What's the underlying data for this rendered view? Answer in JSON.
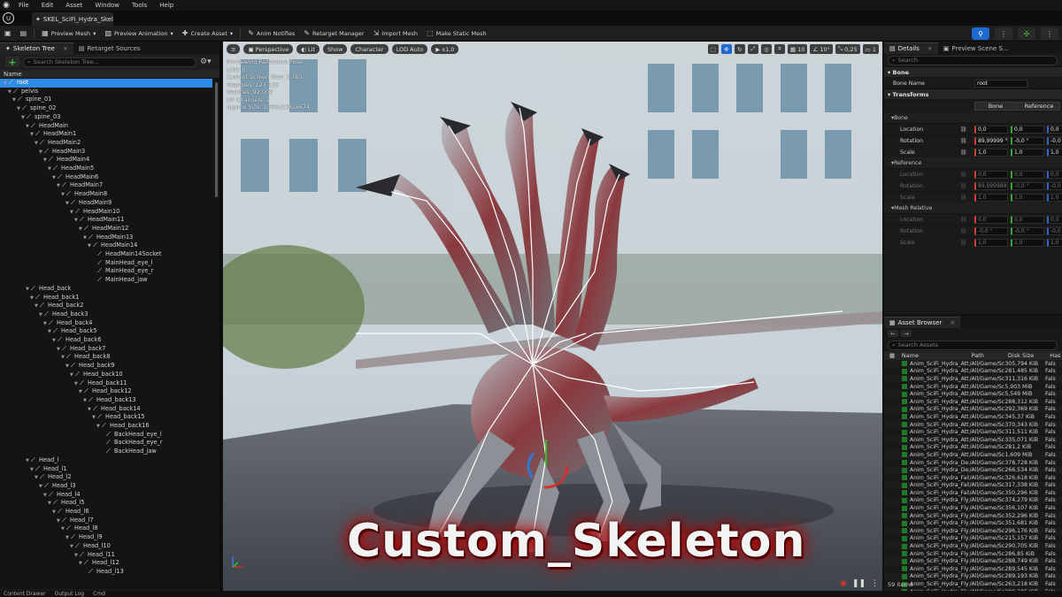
{
  "menu": [
    "File",
    "Edit",
    "Asset",
    "Window",
    "Tools",
    "Help"
  ],
  "document_tab": "SKEL_SciFi_Hydra_Skel...",
  "toolbar": {
    "preview_mesh": "Preview Mesh",
    "preview_animation": "Preview Animation",
    "create_asset": "Create Asset",
    "anim_notifies": "Anim Notifies",
    "retarget_manager": "Retarget Manager",
    "import_mesh": "Import Mesh",
    "make_static_mesh": "Make Static Mesh"
  },
  "left_panel": {
    "tabs": [
      "Skeleton Tree",
      "Retarget Sources"
    ],
    "search_placeholder": "Search Skeleton Tree...",
    "column_name": "Name"
  },
  "skeleton_tree": [
    {
      "name": "root",
      "depth": 0
    },
    {
      "name": "pelvis",
      "depth": 1
    },
    {
      "name": "spine_01",
      "depth": 2
    },
    {
      "name": "spine_02",
      "depth": 3
    },
    {
      "name": "spine_03",
      "depth": 4
    },
    {
      "name": "HeadMain",
      "depth": 5
    },
    {
      "name": "HeadMain1",
      "depth": 6
    },
    {
      "name": "HeadMain2",
      "depth": 7
    },
    {
      "name": "HeadMain3",
      "depth": 8
    },
    {
      "name": "HeadMain4",
      "depth": 9
    },
    {
      "name": "HeadMain5",
      "depth": 10
    },
    {
      "name": "HeadMain6",
      "depth": 11
    },
    {
      "name": "HeadMain7",
      "depth": 12
    },
    {
      "name": "HeadMain8",
      "depth": 13
    },
    {
      "name": "HeadMain9",
      "depth": 14
    },
    {
      "name": "HeadMain10",
      "depth": 15
    },
    {
      "name": "HeadMain11",
      "depth": 16
    },
    {
      "name": "HeadMain12",
      "depth": 17
    },
    {
      "name": "HeadMain13",
      "depth": 18
    },
    {
      "name": "HeadMain14",
      "depth": 19
    },
    {
      "name": "HeadMain14Socket",
      "depth": 20
    },
    {
      "name": "MainHead_eye_l",
      "depth": 20
    },
    {
      "name": "MainHead_eye_r",
      "depth": 20
    },
    {
      "name": "MainHead_jaw",
      "depth": 20
    },
    {
      "name": "Head_back",
      "depth": 5
    },
    {
      "name": "Head_back1",
      "depth": 6
    },
    {
      "name": "Head_back2",
      "depth": 7
    },
    {
      "name": "Head_back3",
      "depth": 8
    },
    {
      "name": "Head_back4",
      "depth": 9
    },
    {
      "name": "Head_back5",
      "depth": 10
    },
    {
      "name": "Head_back6",
      "depth": 11
    },
    {
      "name": "Head_back7",
      "depth": 12
    },
    {
      "name": "Head_back8",
      "depth": 13
    },
    {
      "name": "Head_back9",
      "depth": 14
    },
    {
      "name": "Head_back10",
      "depth": 15
    },
    {
      "name": "Head_back11",
      "depth": 16
    },
    {
      "name": "Head_back12",
      "depth": 17
    },
    {
      "name": "Head_back13",
      "depth": 18
    },
    {
      "name": "Head_back14",
      "depth": 19
    },
    {
      "name": "Head_back15",
      "depth": 20
    },
    {
      "name": "Head_back16",
      "depth": 21
    },
    {
      "name": "BackHead_eye_l",
      "depth": 22
    },
    {
      "name": "BackHead_eye_r",
      "depth": 22
    },
    {
      "name": "BackHead_jaw",
      "depth": 22
    },
    {
      "name": "Head_l",
      "depth": 5
    },
    {
      "name": "Head_l1",
      "depth": 6
    },
    {
      "name": "Head_l2",
      "depth": 7
    },
    {
      "name": "Head_l3",
      "depth": 8
    },
    {
      "name": "Head_l4",
      "depth": 9
    },
    {
      "name": "Head_l5",
      "depth": 10
    },
    {
      "name": "Head_l6",
      "depth": 11
    },
    {
      "name": "Head_l7",
      "depth": 12
    },
    {
      "name": "Head_l8",
      "depth": 13
    },
    {
      "name": "Head_l9",
      "depth": 14
    },
    {
      "name": "Head_l10",
      "depth": 15
    },
    {
      "name": "Head_l11",
      "depth": 16
    },
    {
      "name": "Head_l12",
      "depth": 17
    },
    {
      "name": "Head_l13",
      "depth": 18
    }
  ],
  "viewport": {
    "buttons": [
      "Perspective",
      "Lit",
      "Show",
      "Character",
      "LOD Auto"
    ],
    "play_rate": "x1,0",
    "grid_value": "10",
    "angle_value": "10°",
    "scale_value": "0,25",
    "camera_speed": "1",
    "stats": [
      "Previewing Reference Pose",
      "LOD: 0",
      "Current Screen Size: 1,785",
      "Triangles: 123 133",
      "Vertices: 92 005",
      "UV Channels: 1",
      "Approx Size: 1066x1382x674"
    ],
    "caption": "Custom_Skeleton"
  },
  "details": {
    "tabs": [
      "Details",
      "Preview Scene S..."
    ],
    "search_placeholder": "Search",
    "bone_section": "Bone",
    "bone_name_label": "Bone Name",
    "bone_name_value": "root",
    "transforms_section": "Transforms",
    "bone_button": "Bone",
    "reference_button": "Reference",
    "groups": [
      {
        "title": "Bone",
        "dim": false,
        "rows": [
          {
            "label": "Location",
            "x": "0,0",
            "y": "0,0",
            "z": "0,0"
          },
          {
            "label": "Rotation",
            "x": "89,99999 °",
            "y": "-0,0 °",
            "z": "-0,0 °"
          },
          {
            "label": "Scale",
            "x": "1,0",
            "y": "1,0",
            "z": "1,0"
          }
        ]
      },
      {
        "title": "Reference",
        "dim": true,
        "rows": [
          {
            "label": "Location",
            "x": "0,0",
            "y": "0,0",
            "z": "0,0"
          },
          {
            "label": "Rotation",
            "x": "89,999988 °",
            "y": "-0,0 °",
            "z": "-0,0 °"
          },
          {
            "label": "Scale",
            "x": "1,0",
            "y": "1,0",
            "z": "1,0"
          }
        ]
      },
      {
        "title": "Mesh Relative",
        "dim": true,
        "rows": [
          {
            "label": "Location",
            "x": "0,0",
            "y": "0,0",
            "z": "0,0"
          },
          {
            "label": "Rotation",
            "x": "-0,0 °",
            "y": "-0,0 °",
            "z": "-0,0 °"
          },
          {
            "label": "Scale",
            "x": "1,0",
            "y": "1,0",
            "z": "1,0"
          }
        ]
      }
    ]
  },
  "asset_browser": {
    "title": "Asset Browser",
    "search_placeholder": "Search Assets",
    "columns": [
      "Name",
      "Path",
      "Disk Size",
      "Has"
    ],
    "rows": [
      [
        "Anim_SciFi_Hydra_Atta",
        "/All/Game/Sc",
        "305,794 KiB",
        "Fals"
      ],
      [
        "Anim_SciFi_Hydra_Atta",
        "/All/Game/Sc",
        "281,485 KiB",
        "Fals"
      ],
      [
        "Anim_SciFi_Hydra_Atta",
        "/All/Game/Sc",
        "311,316 KiB",
        "Fals"
      ],
      [
        "Anim_SciFi_Hydra_Atta",
        "/All/Game/Sc",
        "5,903 MiB",
        "Fals"
      ],
      [
        "Anim_SciFi_Hydra_Atta",
        "/All/Game/Sc",
        "5,549 MiB",
        "Fals"
      ],
      [
        "Anim_SciFi_Hydra_Atta",
        "/All/Game/Sc",
        "288,312 KiB",
        "Fals"
      ],
      [
        "Anim_SciFi_Hydra_Atta",
        "/All/Game/Sc",
        "292,369 KiB",
        "Fals"
      ],
      [
        "Anim_SciFi_Hydra_Atta",
        "/All/Game/Sc",
        "345,37 KiB",
        "Fals"
      ],
      [
        "Anim_SciFi_Hydra_Atta",
        "/All/Game/Sc",
        "370,343 KiB",
        "Fals"
      ],
      [
        "Anim_SciFi_Hydra_Atta",
        "/All/Game/Sc",
        "311,511 KiB",
        "Fals"
      ],
      [
        "Anim_SciFi_Hydra_Atta",
        "/All/Game/Sc",
        "335,071 KiB",
        "Fals"
      ],
      [
        "Anim_SciFi_Hydra_Atta",
        "/All/Game/Sc",
        "281,2 KiB",
        "Fals"
      ],
      [
        "Anim_SciFi_Hydra_Atta",
        "/All/Game/Sc",
        "1,609 MiB",
        "Fals"
      ],
      [
        "Anim_SciFi_Hydra_Dea",
        "/All/Game/Sc",
        "378,728 KiB",
        "Fals"
      ],
      [
        "Anim_SciFi_Hydra_Dea",
        "/All/Game/Sc",
        "266,534 KiB",
        "Fals"
      ],
      [
        "Anim_SciFi_Hydra_Fall",
        "/All/Game/Sc",
        "326,618 KiB",
        "Fals"
      ],
      [
        "Anim_SciFi_Hydra_FallI",
        "/All/Game/Sc",
        "317,338 KiB",
        "Fals"
      ],
      [
        "Anim_SciFi_Hydra_Fall",
        "/All/Game/Sc",
        "350,296 KiB",
        "Fals"
      ],
      [
        "Anim_SciFi_Hydra_Fly_",
        "/All/Game/Sc",
        "374,279 KiB",
        "Fals"
      ],
      [
        "Anim_SciFi_Hydra_Fly_",
        "/All/Game/Sc",
        "356,107 KiB",
        "Fals"
      ],
      [
        "Anim_SciFi_Hydra_Fly_",
        "/All/Game/Sc",
        "352,296 KiB",
        "Fals"
      ],
      [
        "Anim_SciFi_Hydra_Fly_",
        "/All/Game/Sc",
        "351,681 KiB",
        "Fals"
      ],
      [
        "Anim_SciFi_Hydra_Fly_",
        "/All/Game/Sc",
        "296,176 KiB",
        "Fals"
      ],
      [
        "Anim_SciFi_Hydra_Fly_",
        "/All/Game/Sc",
        "215,157 KiB",
        "Fals"
      ],
      [
        "Anim_SciFi_Hydra_Fly_",
        "/All/Game/Sc",
        "290,705 KiB",
        "Fals"
      ],
      [
        "Anim_SciFi_Hydra_Flyi",
        "/All/Game/Sc",
        "286,85 KiB",
        "Fals"
      ],
      [
        "Anim_SciFi_Hydra_Flyi",
        "/All/Game/Sc",
        "288,749 KiB",
        "Fals"
      ],
      [
        "Anim_SciFi_Hydra_Flyi",
        "/All/Game/Sc",
        "289,545 KiB",
        "Fals"
      ],
      [
        "Anim_SciFi_Hydra_Flyi",
        "/All/Game/Sc",
        "289,193 KiB",
        "Fals"
      ],
      [
        "Anim_SciFi_Hydra_Flyi",
        "/All/Game/Sc",
        "263,218 KiB",
        "Fals"
      ],
      [
        "Anim_SciFi_Hydra_Flyi",
        "/All/Game/Sc",
        "289,305 KiB",
        "Fals"
      ]
    ],
    "item_count": "59 items"
  },
  "bottom_bar": [
    "Content Drawer",
    "Output Log",
    "Cmd"
  ]
}
